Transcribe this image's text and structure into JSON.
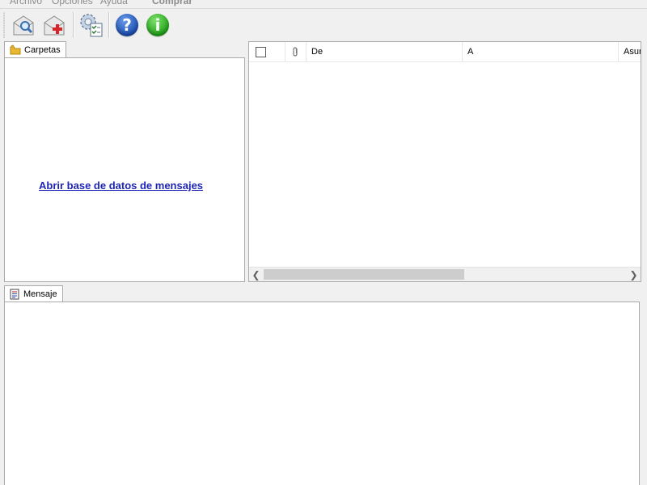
{
  "menubar": {
    "items": [
      "Archivo",
      "Opciones",
      "Ayuda",
      "Comprar"
    ]
  },
  "toolbar": {
    "buttons": [
      {
        "icon": "open-envelope-search-icon"
      },
      {
        "icon": "envelope-add-icon"
      },
      {
        "icon": "settings-checklist-icon"
      },
      {
        "icon": "help-icon",
        "glyph": "?"
      },
      {
        "icon": "info-icon",
        "glyph": "i"
      }
    ]
  },
  "folders_panel": {
    "tab_label": "Carpetas",
    "link": "Abrir base de datos de mensajes"
  },
  "message_list": {
    "columns": [
      "De",
      "A",
      "Asun"
    ]
  },
  "message_panel": {
    "tab_label": "Mensaje"
  },
  "colors": {
    "link": "#1e24b4",
    "help_blue": "#1d4fb3",
    "info_green": "#22a31a",
    "folder_yellow": "#e8b830"
  }
}
